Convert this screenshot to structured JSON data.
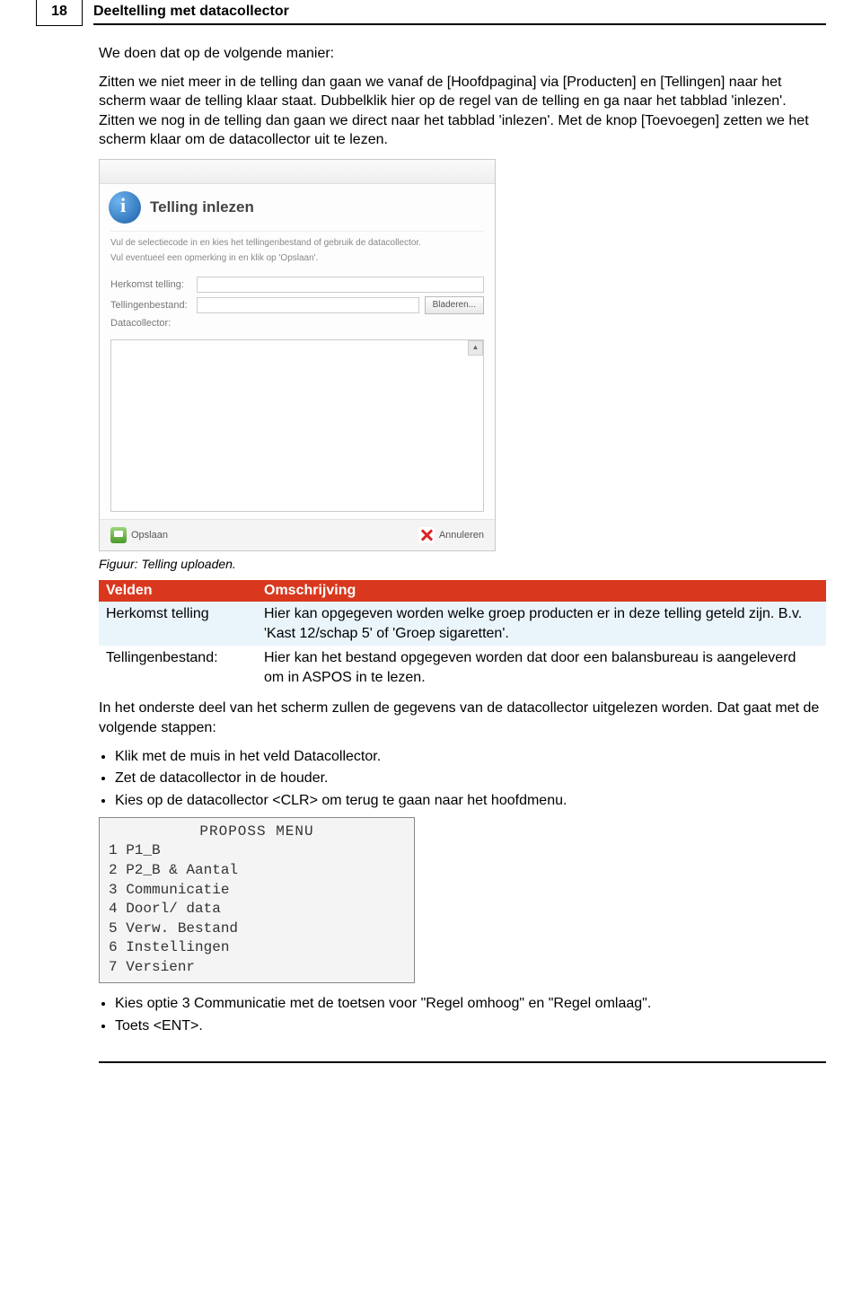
{
  "page_number": "18",
  "header_title": "Deeltelling met datacollector",
  "para1": "We doen dat op de volgende manier:",
  "para2": "Zitten we niet meer in de telling dan gaan we vanaf de [Hoofdpagina] via [Producten] en [Tellingen] naar het scherm waar de telling klaar staat. Dubbelklik hier op de regel van de telling en ga naar het tabblad 'inlezen'. Zitten we nog in de telling dan gaan we direct naar het tabblad 'inlezen'. Met de knop [Toevoegen] zetten we het scherm klaar om de datacollector uit te lezen.",
  "dialog": {
    "title": "Telling inlezen",
    "instr1": "Vul de selectiecode in en kies het tellingenbestand of gebruik de datacollector.",
    "instr2": "Vul eventueel een opmerking in en klik op 'Opslaan'.",
    "label_herkomst": "Herkomst telling:",
    "label_bestand": "Tellingenbestand:",
    "label_collector": "Datacollector:",
    "browse": "Bladeren...",
    "save": "Opslaan",
    "cancel": "Annuleren"
  },
  "caption": "Figuur: Telling uploaden.",
  "table": {
    "h1": "Velden",
    "h2": "Omschrijving",
    "r1c1": "Herkomst telling",
    "r1c2": "Hier kan opgegeven worden welke groep producten er in deze telling geteld zijn. B.v. 'Kast 12/schap 5' of 'Groep sigaretten'.",
    "r2c1": "Tellingenbestand:",
    "r2c2": "Hier kan het bestand opgegeven worden dat door een balansbureau is aangeleverd om in ASPOS in te lezen."
  },
  "para3": "In het onderste deel van het scherm zullen de gegevens van de datacollector uitgelezen worden. Dat gaat met de volgende stappen:",
  "bullets1": [
    "Klik met de muis in het veld Datacollector.",
    "Zet de datacollector in de houder.",
    "Kies op de datacollector <CLR> om terug te gaan naar het hoofdmenu."
  ],
  "menu": {
    "title": "PROPOSS MENU",
    "lines": [
      "1 P1_B",
      "2 P2_B & Aantal",
      "3 Communicatie",
      "4 Doorl/ data",
      "5 Verw. Bestand",
      "6 Instellingen",
      "7 Versienr"
    ]
  },
  "bullets2": [
    "Kies optie 3 Communicatie met de toetsen voor \"Regel omhoog\" en \"Regel omlaag\".",
    "Toets <ENT>."
  ]
}
